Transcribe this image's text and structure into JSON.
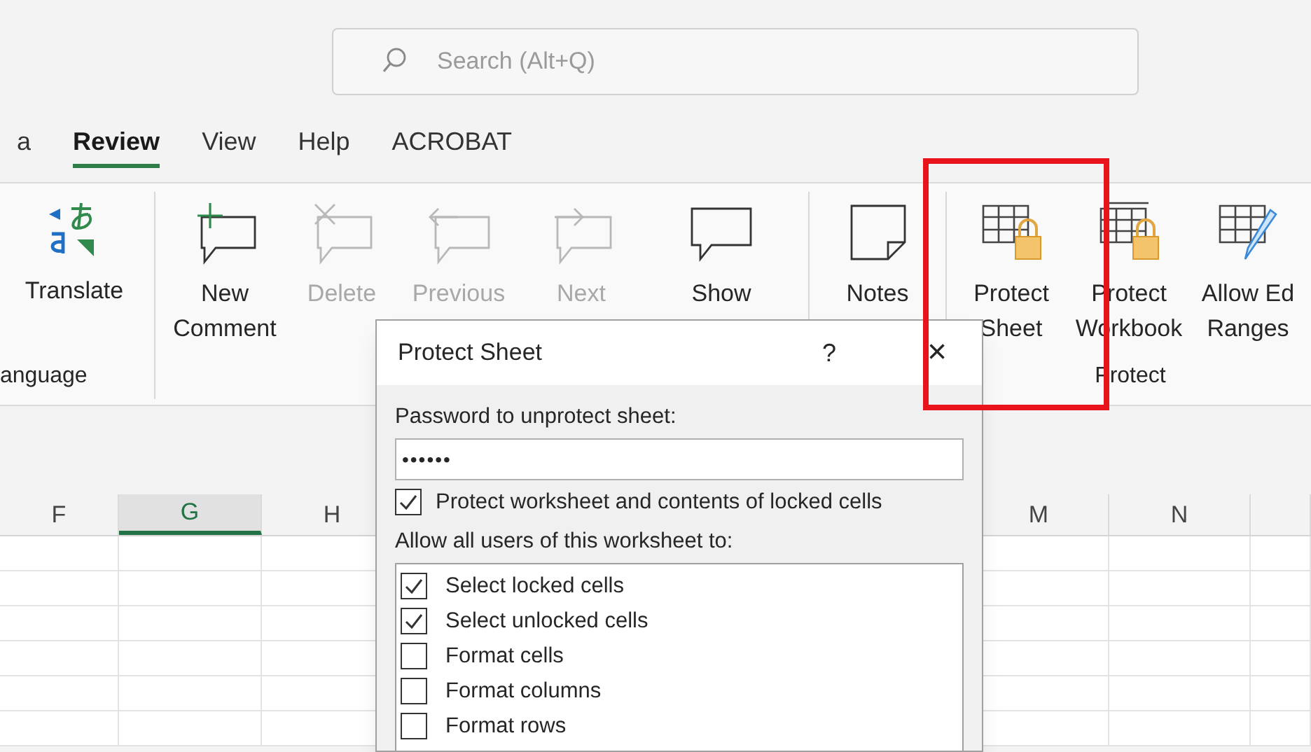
{
  "search": {
    "placeholder": "Search (Alt+Q)"
  },
  "tabs": [
    {
      "label": "a",
      "selected": false
    },
    {
      "label": "Review",
      "selected": true
    },
    {
      "label": "View",
      "selected": false
    },
    {
      "label": "Help",
      "selected": false
    },
    {
      "label": "ACROBAT",
      "selected": false
    }
  ],
  "ribbon_groups": [
    {
      "label": "anguage",
      "buttons": [
        {
          "kind": "translate",
          "lines": [
            "Translate"
          ],
          "disabled": false
        }
      ]
    },
    {
      "buttons": [
        {
          "kind": "new-comment",
          "lines": [
            "New",
            "Comment"
          ],
          "disabled": false
        },
        {
          "kind": "delete-comment",
          "lines": [
            "Delete"
          ],
          "disabled": true
        },
        {
          "kind": "previous-comment",
          "lines": [
            "Previous"
          ],
          "disabled": true
        },
        {
          "kind": "next-comment",
          "lines": [
            "Next"
          ],
          "disabled": true
        },
        {
          "kind": "show-comments",
          "lines": [
            "Show"
          ],
          "disabled": false
        }
      ]
    },
    {
      "buttons": [
        {
          "kind": "notes",
          "lines": [
            "Notes"
          ],
          "disabled": false
        }
      ]
    },
    {
      "label": "Protect",
      "buttons": [
        {
          "kind": "protect-sheet",
          "lines": [
            "Protect",
            "Sheet"
          ],
          "disabled": false
        },
        {
          "kind": "protect-workbook",
          "lines": [
            "Protect",
            "Workbook"
          ],
          "disabled": false
        },
        {
          "kind": "allow-edit",
          "lines": [
            "Allow Ed",
            "Ranges"
          ],
          "disabled": false
        }
      ]
    }
  ],
  "columns": [
    {
      "letter": "F",
      "selected": false
    },
    {
      "letter": "G",
      "selected": true
    },
    {
      "letter": "H",
      "selected": false
    },
    {
      "letter": "M",
      "selected": false
    },
    {
      "letter": "N",
      "selected": false
    }
  ],
  "dialog": {
    "title": "Protect Sheet",
    "help": "?",
    "close": "×",
    "password_label": "Password to unprotect sheet:",
    "password": "••••••",
    "protect_option": {
      "label": "Protect worksheet and contents of locked cells",
      "checked": true
    },
    "allow_label": "Allow all users of this worksheet to:",
    "permissions": [
      {
        "label": "Select locked cells",
        "checked": true
      },
      {
        "label": "Select unlocked cells",
        "checked": true
      },
      {
        "label": "Format cells",
        "checked": false
      },
      {
        "label": "Format columns",
        "checked": false
      },
      {
        "label": "Format rows",
        "checked": false
      }
    ]
  },
  "highlight": {
    "kind": "red-frame"
  }
}
